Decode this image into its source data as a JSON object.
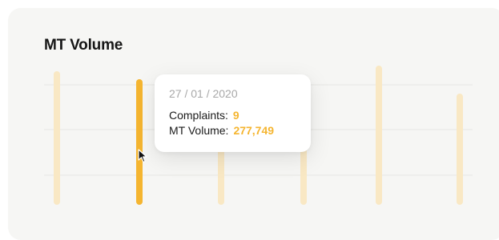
{
  "card": {
    "title": "MT Volume"
  },
  "chart_data": {
    "type": "bar",
    "title": "MT Volume",
    "gridlines": 3,
    "bars": [
      {
        "highlighted": false
      },
      {
        "highlighted": true,
        "date": "27 / 01 / 2020",
        "complaints": 9,
        "mt_volume": "277,749"
      },
      {
        "highlighted": false
      },
      {
        "highlighted": false
      },
      {
        "highlighted": false
      },
      {
        "highlighted": false
      }
    ],
    "colors": {
      "bar_active": "#f5b530",
      "bar_faded": "#f9e8c4",
      "grid": "#e6e6e3"
    }
  },
  "tooltip": {
    "date": "27 / 01 / 2020",
    "complaints_label": "Complaints:",
    "complaints_value": "9",
    "volume_label": "MT Volume:",
    "volume_value": "277,749"
  },
  "cursor": {
    "icon": "arrow-cursor-icon"
  }
}
